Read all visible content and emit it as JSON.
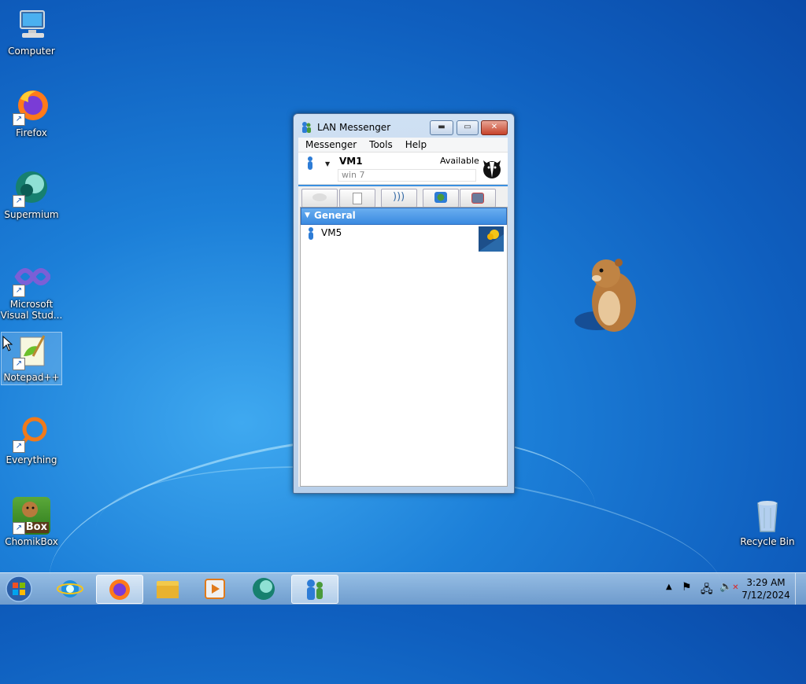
{
  "desktop": {
    "icons": [
      {
        "label": "Computer",
        "icon": "computer-icon"
      },
      {
        "label": "Firefox",
        "icon": "firefox-icon"
      },
      {
        "label": "Supermium",
        "icon": "supermium-icon"
      },
      {
        "label": "Microsoft Visual Stud...",
        "icon": "visual-studio-icon"
      },
      {
        "label": "Notepad++",
        "icon": "notepad-plus-plus-icon"
      },
      {
        "label": "Everything",
        "icon": "everything-icon"
      },
      {
        "label": "ChomikBox",
        "icon": "chomikbox-icon"
      },
      {
        "label": "Recycle Bin",
        "icon": "recycle-bin-icon"
      }
    ],
    "chomikbox_badge": "Box"
  },
  "window": {
    "title": "LAN Messenger",
    "menu": [
      "Messenger",
      "Tools",
      "Help"
    ],
    "user": {
      "name": "VM1",
      "status": "Available",
      "note": "win 7"
    },
    "toolbar_icons": [
      "chat-icon",
      "file-transfer-icon",
      "broadcast-icon",
      "add-contact-icon",
      "settings-icon"
    ],
    "group": {
      "name": "General",
      "contacts": [
        {
          "name": "VM5",
          "avatar": "flower-avatar"
        }
      ]
    }
  },
  "taskbar": {
    "apps": [
      "internet-explorer-icon",
      "firefox-icon",
      "file-explorer-icon",
      "media-player-icon",
      "supermium-icon",
      "lan-messenger-icon"
    ],
    "tray_icons": [
      "show-hidden-icon",
      "action-center-flag-icon",
      "network-icon",
      "volume-muted-icon"
    ],
    "time": "3:29 AM",
    "date": "7/12/2024"
  },
  "colors": {
    "desktop_blue": "#1c7fd8",
    "selection_blue": "#3a8ae0"
  }
}
